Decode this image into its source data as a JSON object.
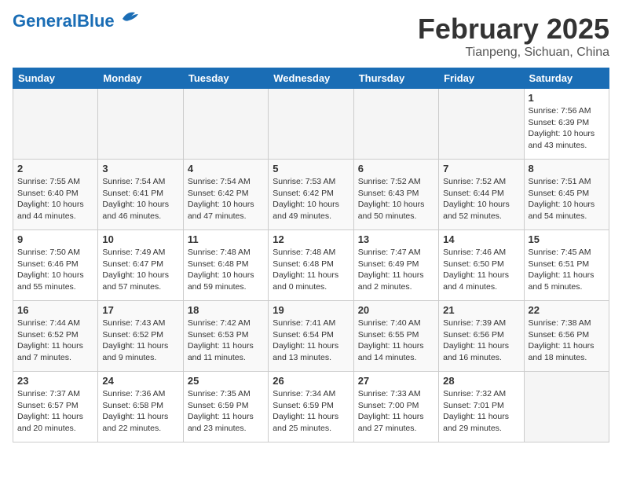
{
  "header": {
    "logo_general": "General",
    "logo_blue": "Blue",
    "month_year": "February 2025",
    "location": "Tianpeng, Sichuan, China"
  },
  "weekdays": [
    "Sunday",
    "Monday",
    "Tuesday",
    "Wednesday",
    "Thursday",
    "Friday",
    "Saturday"
  ],
  "weeks": [
    [
      {
        "day": "",
        "info": ""
      },
      {
        "day": "",
        "info": ""
      },
      {
        "day": "",
        "info": ""
      },
      {
        "day": "",
        "info": ""
      },
      {
        "day": "",
        "info": ""
      },
      {
        "day": "",
        "info": ""
      },
      {
        "day": "1",
        "info": "Sunrise: 7:56 AM\nSunset: 6:39 PM\nDaylight: 10 hours and 43 minutes."
      }
    ],
    [
      {
        "day": "2",
        "info": "Sunrise: 7:55 AM\nSunset: 6:40 PM\nDaylight: 10 hours and 44 minutes."
      },
      {
        "day": "3",
        "info": "Sunrise: 7:54 AM\nSunset: 6:41 PM\nDaylight: 10 hours and 46 minutes."
      },
      {
        "day": "4",
        "info": "Sunrise: 7:54 AM\nSunset: 6:42 PM\nDaylight: 10 hours and 47 minutes."
      },
      {
        "day": "5",
        "info": "Sunrise: 7:53 AM\nSunset: 6:42 PM\nDaylight: 10 hours and 49 minutes."
      },
      {
        "day": "6",
        "info": "Sunrise: 7:52 AM\nSunset: 6:43 PM\nDaylight: 10 hours and 50 minutes."
      },
      {
        "day": "7",
        "info": "Sunrise: 7:52 AM\nSunset: 6:44 PM\nDaylight: 10 hours and 52 minutes."
      },
      {
        "day": "8",
        "info": "Sunrise: 7:51 AM\nSunset: 6:45 PM\nDaylight: 10 hours and 54 minutes."
      }
    ],
    [
      {
        "day": "9",
        "info": "Sunrise: 7:50 AM\nSunset: 6:46 PM\nDaylight: 10 hours and 55 minutes."
      },
      {
        "day": "10",
        "info": "Sunrise: 7:49 AM\nSunset: 6:47 PM\nDaylight: 10 hours and 57 minutes."
      },
      {
        "day": "11",
        "info": "Sunrise: 7:48 AM\nSunset: 6:48 PM\nDaylight: 10 hours and 59 minutes."
      },
      {
        "day": "12",
        "info": "Sunrise: 7:48 AM\nSunset: 6:48 PM\nDaylight: 11 hours and 0 minutes."
      },
      {
        "day": "13",
        "info": "Sunrise: 7:47 AM\nSunset: 6:49 PM\nDaylight: 11 hours and 2 minutes."
      },
      {
        "day": "14",
        "info": "Sunrise: 7:46 AM\nSunset: 6:50 PM\nDaylight: 11 hours and 4 minutes."
      },
      {
        "day": "15",
        "info": "Sunrise: 7:45 AM\nSunset: 6:51 PM\nDaylight: 11 hours and 5 minutes."
      }
    ],
    [
      {
        "day": "16",
        "info": "Sunrise: 7:44 AM\nSunset: 6:52 PM\nDaylight: 11 hours and 7 minutes."
      },
      {
        "day": "17",
        "info": "Sunrise: 7:43 AM\nSunset: 6:52 PM\nDaylight: 11 hours and 9 minutes."
      },
      {
        "day": "18",
        "info": "Sunrise: 7:42 AM\nSunset: 6:53 PM\nDaylight: 11 hours and 11 minutes."
      },
      {
        "day": "19",
        "info": "Sunrise: 7:41 AM\nSunset: 6:54 PM\nDaylight: 11 hours and 13 minutes."
      },
      {
        "day": "20",
        "info": "Sunrise: 7:40 AM\nSunset: 6:55 PM\nDaylight: 11 hours and 14 minutes."
      },
      {
        "day": "21",
        "info": "Sunrise: 7:39 AM\nSunset: 6:56 PM\nDaylight: 11 hours and 16 minutes."
      },
      {
        "day": "22",
        "info": "Sunrise: 7:38 AM\nSunset: 6:56 PM\nDaylight: 11 hours and 18 minutes."
      }
    ],
    [
      {
        "day": "23",
        "info": "Sunrise: 7:37 AM\nSunset: 6:57 PM\nDaylight: 11 hours and 20 minutes."
      },
      {
        "day": "24",
        "info": "Sunrise: 7:36 AM\nSunset: 6:58 PM\nDaylight: 11 hours and 22 minutes."
      },
      {
        "day": "25",
        "info": "Sunrise: 7:35 AM\nSunset: 6:59 PM\nDaylight: 11 hours and 23 minutes."
      },
      {
        "day": "26",
        "info": "Sunrise: 7:34 AM\nSunset: 6:59 PM\nDaylight: 11 hours and 25 minutes."
      },
      {
        "day": "27",
        "info": "Sunrise: 7:33 AM\nSunset: 7:00 PM\nDaylight: 11 hours and 27 minutes."
      },
      {
        "day": "28",
        "info": "Sunrise: 7:32 AM\nSunset: 7:01 PM\nDaylight: 11 hours and 29 minutes."
      },
      {
        "day": "",
        "info": ""
      }
    ]
  ]
}
